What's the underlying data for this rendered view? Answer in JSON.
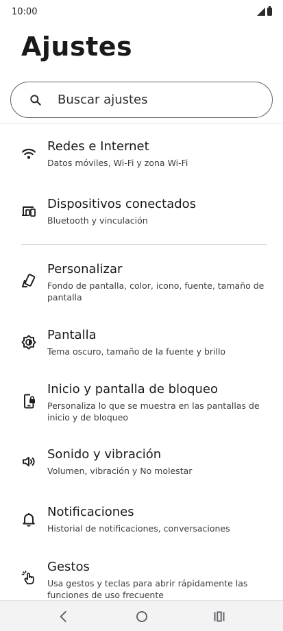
{
  "status_bar": {
    "time": "10:00"
  },
  "page": {
    "title": "Ajustes"
  },
  "search": {
    "placeholder": "Buscar ajustes"
  },
  "items": [
    {
      "icon": "wifi-icon",
      "title": "Redes e Internet",
      "subtitle": "Datos móviles, Wi-Fi y zona Wi-Fi"
    },
    {
      "icon": "connected-devices-icon",
      "title": "Dispositivos conectados",
      "subtitle": "Bluetooth y vinculación"
    },
    {
      "icon": "personalize-icon",
      "title": "Personalizar",
      "subtitle": "Fondo de pantalla, color, icono, fuente, tamaño de pantalla"
    },
    {
      "icon": "display-brightness-icon",
      "title": "Pantalla",
      "subtitle": "Tema oscuro, tamaño de la fuente y brillo"
    },
    {
      "icon": "lock-screen-icon",
      "title": "Inicio y pantalla de bloqueo",
      "subtitle": "Personaliza lo que se muestra en las pantallas de inicio y de bloqueo"
    },
    {
      "icon": "volume-icon",
      "title": "Sonido y vibración",
      "subtitle": "Volumen, vibración y No molestar"
    },
    {
      "icon": "bell-icon",
      "title": "Notificaciones",
      "subtitle": "Historial de notificaciones, conversaciones"
    },
    {
      "icon": "gesture-hand-icon",
      "title": "Gestos",
      "subtitle": "Usa gestos y teclas para abrir rápidamente las funciones de uso frecuente"
    }
  ],
  "nav_bar": {
    "buttons": [
      "back-icon",
      "home-icon",
      "recents-icon"
    ]
  }
}
